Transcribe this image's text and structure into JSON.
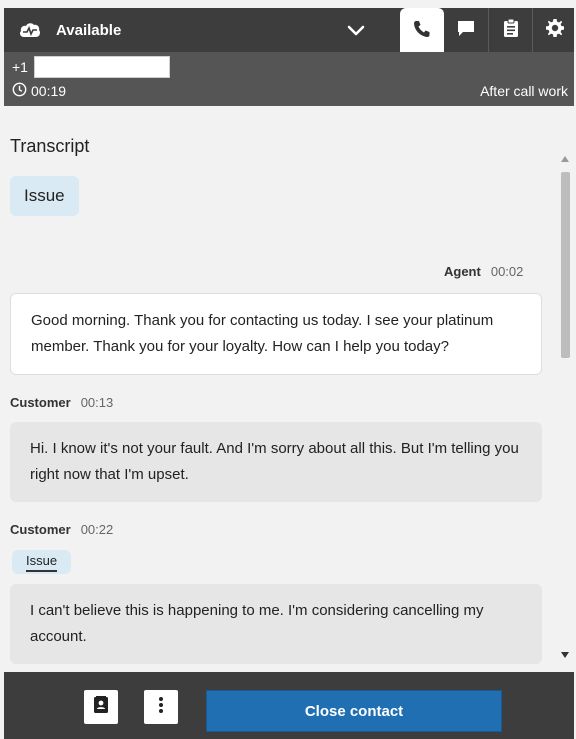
{
  "header": {
    "status_label": "Available",
    "icons": [
      "cloud-icon",
      "chevron-down-icon",
      "phone-icon",
      "chat-icon",
      "clipboard-icon",
      "gear-icon"
    ]
  },
  "call": {
    "phone_prefix": "+1",
    "phone_number": "",
    "timer": "00:19",
    "state": "After call work"
  },
  "transcript": {
    "title": "Transcript",
    "summary_chip": "Issue",
    "messages": [
      {
        "speaker": "Agent",
        "time": "00:02",
        "text": "Good morning. Thank you for contacting us today. I see your platinum member. Thank you for your loyalty. How can I help you today?"
      },
      {
        "speaker": "Customer",
        "time": "00:13",
        "text": "Hi. I know it's not your fault. And I'm sorry about all this. But I'm telling you right now that I'm upset."
      },
      {
        "speaker": "Customer",
        "time": "00:22",
        "tag": "Issue",
        "text": "I can't believe this is happening to me. I'm considering cancelling my account."
      }
    ]
  },
  "footer": {
    "close_label": "Close contact"
  },
  "colors": {
    "topbar": "#3d3d3d",
    "callhdr": "#555555",
    "accent": "#1f6fb2",
    "chip": "#d9eaf4"
  }
}
